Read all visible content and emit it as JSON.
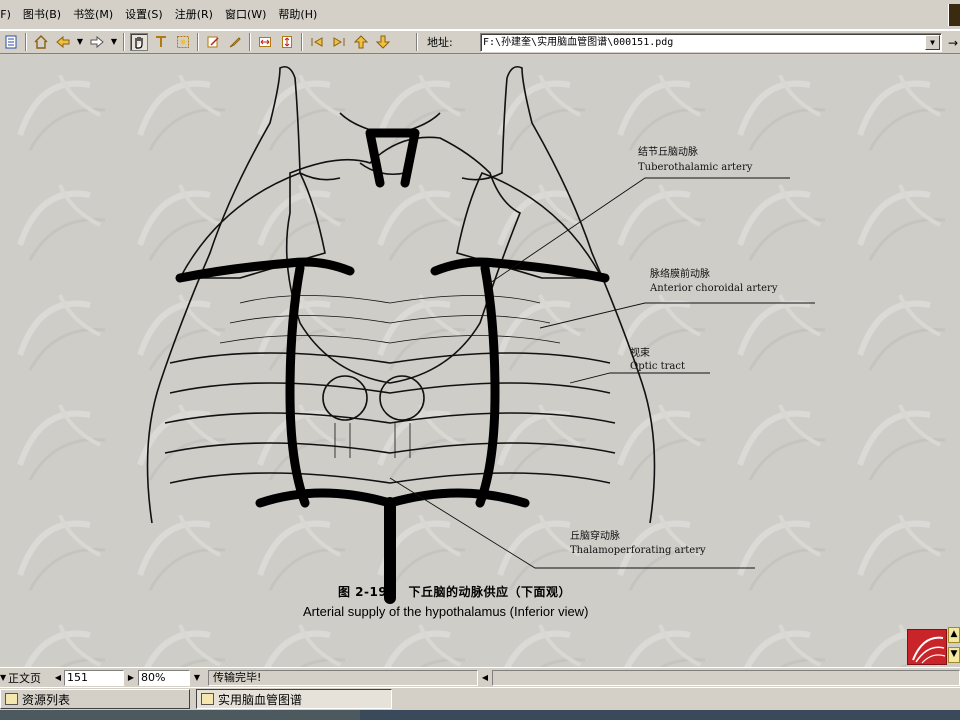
{
  "menubar": {
    "items": [
      {
        "label": "(F)"
      },
      {
        "label": "图书(B)"
      },
      {
        "label": "书签(M)"
      },
      {
        "label": "设置(S)"
      },
      {
        "label": "注册(R)"
      },
      {
        "label": "窗口(W)"
      },
      {
        "label": "帮助(H)"
      }
    ]
  },
  "toolbar": {
    "address_label": "地址:",
    "address_value": "F:\\孙建奎\\实用脑血管图谱\\000151.pdg",
    "icons": {
      "home": "home-icon",
      "back": "back-arrow-icon",
      "forward": "forward-arrow-icon",
      "hand": "hand-tool-icon",
      "text": "text-select-icon",
      "zoom_area": "select-area-icon",
      "annotate": "annotate-icon",
      "highlight": "highlight-icon",
      "fit_width": "fit-width-icon",
      "fit_height": "fit-height-icon",
      "prev_page": "previous-page-icon",
      "next_page": "next-page-icon",
      "page_up": "page-up-icon",
      "page_down": "page-down-icon"
    }
  },
  "figure": {
    "labels": {
      "tuberothalamic_cn": "结节丘脑动脉",
      "tuberothalamic_en": "Tuberothalamic artery",
      "choroidal_cn": "脉络膜前动脉",
      "choroidal_en": "Anterior choroidal artery",
      "optic_cn": "视束",
      "optic_en": "Optic tract",
      "thalamo_cn": "丘脑穿动脉",
      "thalamo_en": "Thalamoperforating artery"
    },
    "caption_cn": "图 2-198　下丘脑的动脉供应（下面观）",
    "caption_en": "Arterial supply of the hypothalamus (Inferior view)"
  },
  "statusbar": {
    "page_mode": "正文页",
    "page_number": "151",
    "zoom": "80%",
    "transfer_status": "传输完毕!"
  },
  "taskbar": {
    "resource_list": "资源列表",
    "book_title": "实用脑血管图谱"
  }
}
